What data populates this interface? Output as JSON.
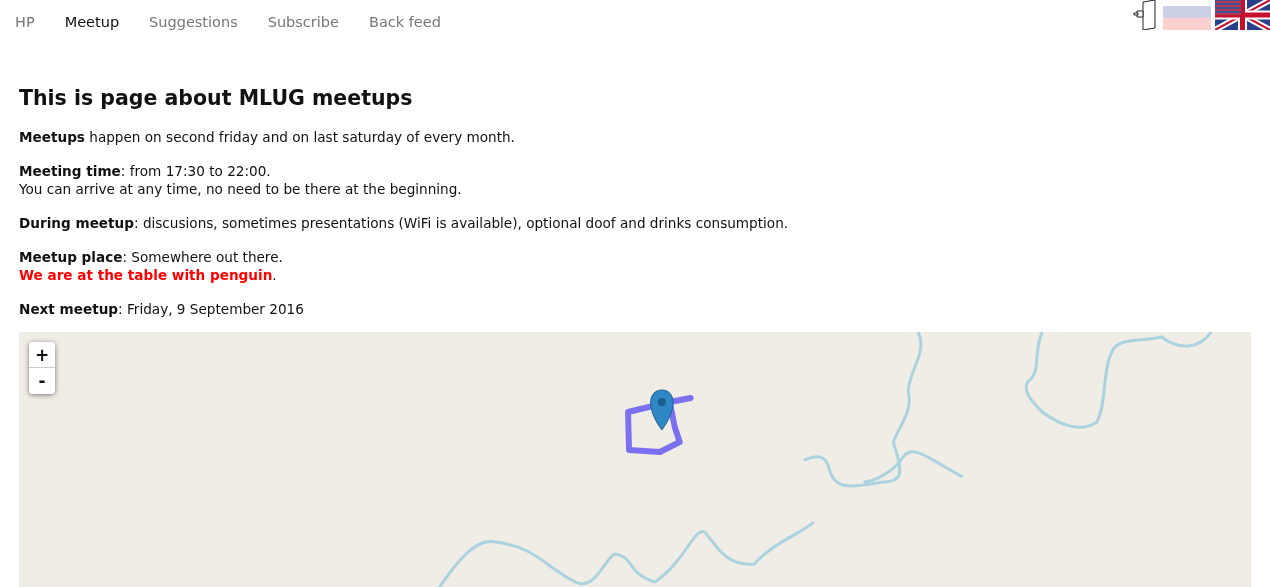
{
  "nav": {
    "items": [
      {
        "label": "HP",
        "selected": false
      },
      {
        "label": "Meetup",
        "selected": true
      },
      {
        "label": "Suggestions",
        "selected": false
      },
      {
        "label": "Subscribe",
        "selected": false
      },
      {
        "label": "Back feed",
        "selected": false
      }
    ]
  },
  "heading": "This is page about MLUG meetups",
  "paragraphs": [
    [
      {
        "text": "**Meetups** happen on second friday and on last saturday of every month.",
        "kind": "plain"
      }
    ],
    [
      {
        "text": "**Meeting time**: from 17:30 to 22:00.",
        "kind": "plain"
      },
      {
        "text": "You can arrive at any time, no need to be there at the beginning.",
        "kind": "plain"
      }
    ],
    [
      {
        "text": "**During meetup**: discusions, sometimes presentations (WiFi is available), optional doof and drinks consumption.",
        "kind": "plain"
      }
    ],
    [
      {
        "text": "**Meetup place**: Somewhere out there.",
        "kind": "plain"
      },
      {
        "text": "**We are at the table with penguin**.",
        "kind": "alert"
      }
    ],
    [
      {
        "text": "**Next meetup**: Friday, 9 September 2016",
        "kind": "plain"
      }
    ]
  ],
  "map": {
    "zoom_in": "+",
    "zoom_out": "-"
  }
}
